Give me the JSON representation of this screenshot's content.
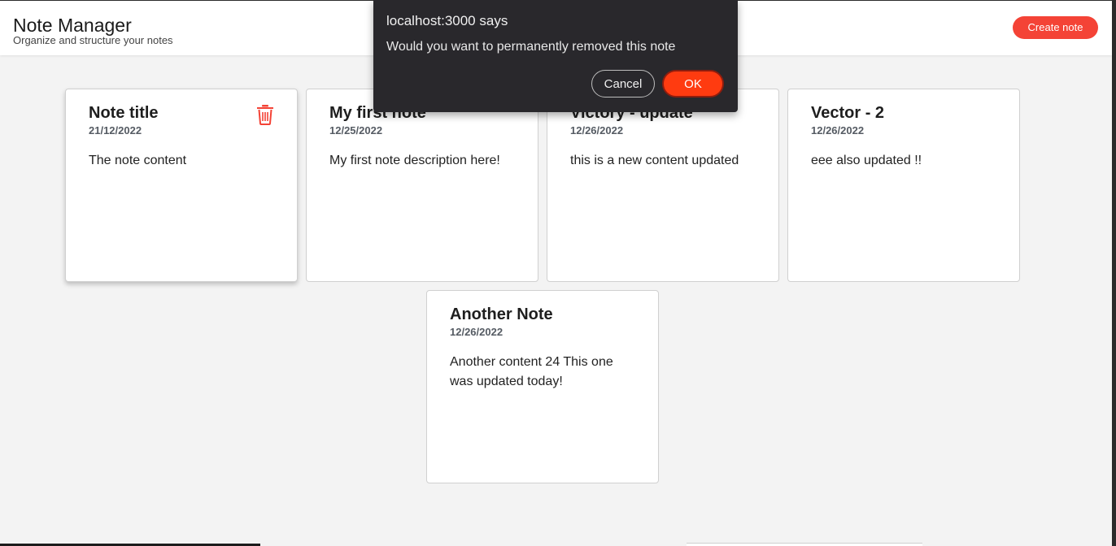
{
  "header": {
    "title": "Note Manager",
    "subtitle": "Organize and structure your notes",
    "create_label": "Create note"
  },
  "notes": [
    {
      "title": "Note title",
      "date": "21/12/2022",
      "content": "The note content"
    },
    {
      "title": "My first note",
      "date": "12/25/2022",
      "content": "My first note description here!"
    },
    {
      "title": "Victory - update",
      "date": "12/26/2022",
      "content": "this is a new content updated"
    },
    {
      "title": "Vector - 2",
      "date": "12/26/2022",
      "content": "eee also updated !!"
    },
    {
      "title": "Another Note",
      "date": "12/26/2022",
      "content": "Another content 24 This one was updated today!"
    }
  ],
  "dialog": {
    "title": "localhost:3000 says",
    "message": "Would you want to permanently removed this note",
    "cancel_label": "Cancel",
    "ok_label": "OK"
  },
  "colors": {
    "accent": "#f44336",
    "dialog_bg": "#29282c",
    "ok_button": "#ff3b10"
  },
  "icons": {
    "delete": "trash-icon"
  }
}
